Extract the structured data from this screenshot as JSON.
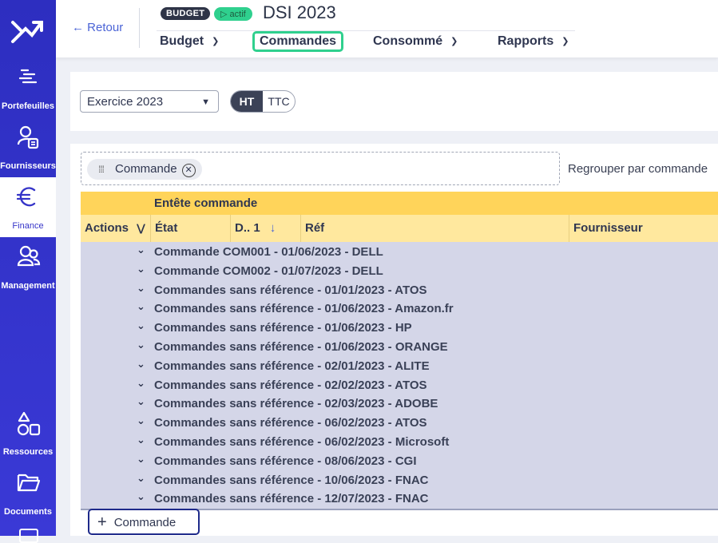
{
  "sidebar": {
    "items": [
      {
        "label": "Portefeuilles",
        "icon": "portfolios-icon"
      },
      {
        "label": "Fournisseurs",
        "icon": "suppliers-icon"
      },
      {
        "label": "Finance",
        "icon": "euro-icon",
        "active": true
      },
      {
        "label": "Management",
        "icon": "users-icon"
      },
      {
        "label": "Ressources",
        "icon": "shapes-icon"
      },
      {
        "label": "Documents",
        "icon": "folder-icon"
      }
    ]
  },
  "header": {
    "back_label": "← Retour",
    "badge_type": "BUDGET",
    "badge_status": "▷ actif",
    "title": "DSI 2023",
    "tabs": [
      {
        "label": "Budget",
        "dropdown": true
      },
      {
        "label": "Commandes",
        "dropdown": false,
        "active": true
      },
      {
        "label": "Consommé",
        "dropdown": true
      },
      {
        "label": "Rapports",
        "dropdown": true
      }
    ]
  },
  "filters": {
    "exercise_value": "Exercice 2023",
    "toggle_ht": "HT",
    "toggle_ttc": "TTC"
  },
  "grid": {
    "group_chip": "Commande",
    "group_hint": "Regrouper par commande",
    "header_group": "Entête commande",
    "columns": {
      "actions": "Actions",
      "etat": "État",
      "date": "D.. 1",
      "ref": "Réf",
      "fournisseur": "Fournisseur"
    },
    "rows": [
      "Commande COM001 - 01/06/2023 - DELL",
      "Commande COM002 - 01/07/2023 - DELL",
      "Commandes sans référence - 01/01/2023 - ATOS",
      "Commandes sans référence - 01/06/2023 - Amazon.fr",
      "Commandes sans référence - 01/06/2023 - HP",
      "Commandes sans référence - 01/06/2023 - ORANGE",
      "Commandes sans référence - 02/01/2023 - ALITE",
      "Commandes sans référence - 02/02/2023 - ATOS",
      "Commandes sans référence - 02/03/2023 - ADOBE",
      "Commandes sans référence - 06/02/2023 - ATOS",
      "Commandes sans référence - 06/02/2023 - Microsoft",
      "Commandes sans référence - 08/06/2023 - CGI",
      "Commandes sans référence - 10/06/2023 - FNAC",
      "Commandes sans référence - 12/07/2023 - FNAC"
    ],
    "add_label": "Commande"
  },
  "colors": {
    "sidebar": "#2d2ec0",
    "accent_green": "#2fd08e",
    "header_yellow": "#ffd45a",
    "row_bg": "#d4d6e8"
  }
}
